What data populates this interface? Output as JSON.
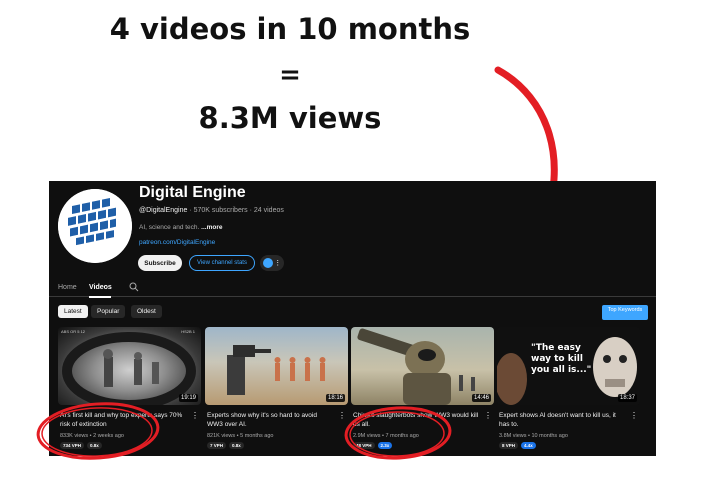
{
  "headline": {
    "line1": "4 videos in 10 months",
    "line2": "=",
    "line3": "8.3M views"
  },
  "colors": {
    "annotation_red": "#e31e24",
    "link_blue": "#3ea6ff",
    "background": "#0f0f0f"
  },
  "channel": {
    "name": "Digital Engine",
    "handle": "@DigitalEngine",
    "stats": " · 570K subscribers · 24 videos",
    "description": "AI, science and tech.",
    "more": " ...more",
    "link": "patreon.com/DigitalEngine",
    "avatar_icon": "globe-logo-icon",
    "subscribe_label": "Subscribe",
    "view_stats_label": "View channel stats"
  },
  "tabs": [
    {
      "label": "Home"
    },
    {
      "label": "Videos",
      "active": true
    }
  ],
  "filters": {
    "chips": [
      "Latest",
      "Popular",
      "Oldest"
    ],
    "keywords_button": "Top Keywords"
  },
  "videos": [
    {
      "title": "AI's first kill and why top experts says 70% risk of extinction",
      "meta": "833K views • 2 weeks ago",
      "duration": "19:19",
      "vph": "734 VPH",
      "multiplier": "0.8x",
      "multiplier_highlight": false,
      "overlay_left": "ABS OR 5   12",
      "overlay_right": "HS2B 1"
    },
    {
      "title": "Experts show why it's so hard to avoid WW3 over AI.",
      "meta": "821K views • 5 months ago",
      "duration": "18:16",
      "vph": "7 VPH",
      "multiplier": "0.8x",
      "multiplier_highlight": false
    },
    {
      "title": "China's slaughterbots show WW3 would kill us all.",
      "meta": "2.9M views • 7 months ago",
      "duration": "14:46",
      "vph": "48 VPH",
      "multiplier": "2.3x",
      "multiplier_highlight": true
    },
    {
      "title": "Expert shows AI doesn't want to kill us, it has to.",
      "meta": "3.8M views • 10 months ago",
      "duration": "18:37",
      "vph": "8 VPH",
      "multiplier": "4.4x",
      "multiplier_highlight": true,
      "quote": "\"The easy way to kill you all is...\""
    }
  ]
}
